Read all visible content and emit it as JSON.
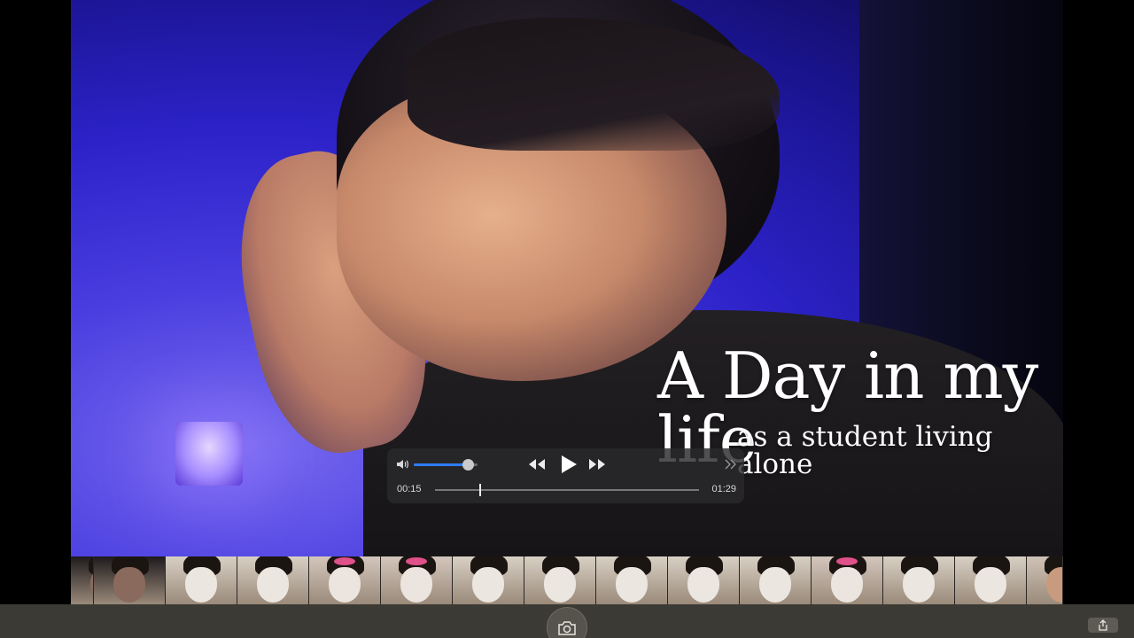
{
  "video": {
    "title_line1": "A Day in my life",
    "title_line2": "as a student living alone"
  },
  "player_controls": {
    "current_time": "00:15",
    "duration": "01:29",
    "playback_progress": 0.17,
    "volume_level": 0.85,
    "volume_icon": "speaker-icon",
    "rewind_icon": "rewind-icon",
    "play_icon": "play-icon",
    "fast_forward_icon": "fast-forward-icon",
    "expand_icon": "double-chevron-right-icon",
    "accent_color": "#2f7cf6"
  },
  "filmstrip": {
    "frames": [
      {
        "tone": "dark"
      },
      {
        "tone": "dark"
      },
      {
        "tone": "mask"
      },
      {
        "tone": "mask"
      },
      {
        "tone": "mask-bow"
      },
      {
        "tone": "mask-bow"
      },
      {
        "tone": "mask"
      },
      {
        "tone": "mask"
      },
      {
        "tone": "mask"
      },
      {
        "tone": "mask"
      },
      {
        "tone": "mask"
      },
      {
        "tone": "mask-bow"
      },
      {
        "tone": "mask"
      },
      {
        "tone": "mask"
      },
      {
        "tone": "face"
      }
    ]
  },
  "toolbar": {
    "screenshot_icon": "camera-icon",
    "share_icon": "share-icon"
  }
}
